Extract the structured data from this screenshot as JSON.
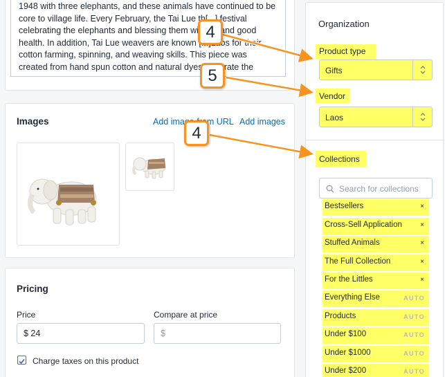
{
  "description": {
    "lines": [
      "1948 with three elephants, and these animals have continued to be",
      "core to village life. Every February, the Tai Lue th[...] festival",
      "celebrating the elephants and blessing them wi[...]fe and good",
      "health. In addition, Tai Lue weavers are known [...]Laos for their",
      "cotton farming, spinning, and weaving skills. This piece was",
      "created from hand spun cotton and natural dyes[...]ebrate the"
    ]
  },
  "images": {
    "title": "Images",
    "add_url_label": "Add image from URL",
    "add_images_label": "Add images",
    "items": [
      "elephant-main",
      "elephant-thumb"
    ]
  },
  "pricing": {
    "title": "Pricing",
    "price_label": "Price",
    "price_value": "$ 24",
    "compare_label": "Compare at price",
    "compare_placeholder": "$",
    "charge_taxes_label": "Charge taxes on this product",
    "charge_taxes_checked": true
  },
  "organization": {
    "title": "Organization",
    "product_type_label": "Product type",
    "product_type_value": "Gifts",
    "vendor_label": "Vendor",
    "vendor_value": "Laos",
    "collections_label": "Collections",
    "search_placeholder": "Search for collections",
    "collections": [
      {
        "name": "Bestsellers",
        "action": "×"
      },
      {
        "name": "Cross-Sell Application",
        "action": "×"
      },
      {
        "name": "Stuffed Animals",
        "action": "×"
      },
      {
        "name": "The Full Collection",
        "action": "×"
      },
      {
        "name": "For the Littles",
        "action": "×"
      },
      {
        "name": "Everything Else",
        "action": "AUTO"
      },
      {
        "name": "Products",
        "action": "AUTO"
      },
      {
        "name": "Under $100",
        "action": "AUTO"
      },
      {
        "name": "Under $1000",
        "action": "AUTO"
      },
      {
        "name": "Under $200",
        "action": "AUTO"
      }
    ]
  },
  "annotations": {
    "badge_product_type": "4",
    "badge_vendor": "5",
    "badge_collections": "4",
    "badge_color": "#f7931e",
    "highlight_color": "#ffff66"
  }
}
